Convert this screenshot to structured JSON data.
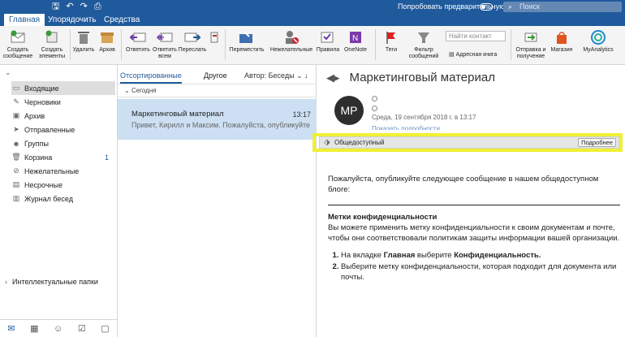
{
  "titlebar": {
    "icons": [
      "grid-icon",
      "save-icon",
      "undo-icon",
      "redo-icon",
      "print-icon"
    ],
    "preview_label": "Попробовать предварительную версию",
    "search_placeholder": "Поиск"
  },
  "tabs": [
    "Главная",
    "Упорядочить",
    "Средства"
  ],
  "ribbon": {
    "new_email": "Создать сообщение",
    "new_items": "Создать элементы",
    "delete": "Удалить",
    "archive": "Архив",
    "reply": "Ответить",
    "reply_all": "Ответить всем",
    "forward": "Переслать",
    "move": "Переместить",
    "junk": "Нежелательные",
    "rules": "Правила",
    "onenote": "OneNote",
    "tags": "Теги",
    "filter": "Фильтр сообщений",
    "find_contact_placeholder": "Найти контакт",
    "address_book": "Адресная книга",
    "send_receive": "Отправка и получение",
    "store": "Магазин",
    "myanalytics": "MyAnalytics"
  },
  "folders": [
    {
      "name": "Входящие",
      "count": "",
      "icon": "inbox-icon",
      "selected": true
    },
    {
      "name": "Черновики",
      "count": "",
      "icon": "drafts-icon"
    },
    {
      "name": "Архив",
      "count": "",
      "icon": "archive-icon"
    },
    {
      "name": "Отправленные",
      "count": "",
      "icon": "sent-icon"
    },
    {
      "name": "Группы",
      "count": "",
      "icon": "groups-icon"
    },
    {
      "name": "Корзина",
      "count": "1",
      "icon": "trash-icon"
    },
    {
      "name": "Нежелательные",
      "count": "",
      "icon": "junk-icon"
    },
    {
      "name": "Несрочные",
      "count": "",
      "icon": "clutter-icon"
    },
    {
      "name": "Журнал бесед",
      "count": "",
      "icon": "conversation-history-icon"
    }
  ],
  "smart_folders": "Интеллектуальные папки",
  "message_list": {
    "tab_focused": "Отсортированные",
    "tab_other": "Другое",
    "sort_by": "Автор: Беседы",
    "group_today": "Сегодня",
    "message": {
      "subject": "Маркетинговый материал",
      "time": "13:17",
      "preview": "Привет, Кирилл и Максим. Пожалуйста, опубликуйте..."
    }
  },
  "reading": {
    "subject": "Маркетинговый материал",
    "avatar": "MP",
    "date": "Среда, 19 сентября 2018 г. в 13:17",
    "details": "Показать подробности",
    "label": "Общедоступный",
    "label_more": "Подробнее",
    "intro": "Пожалуйста, опубликуйте следующее сообщение в нашем общедоступном блоге:",
    "heading": "Метки конфиденциальности",
    "paragraph": "Вы можете применить метку конфиденциальности к своим документам и почте, чтобы они соответствовали политикам защиты информации вашей организации.",
    "step1_pre": "На вкладке ",
    "step1_b1": "Главная",
    "step1_mid": " выберите ",
    "step1_b2": "Конфиденциальность.",
    "step2": "Выберите метку конфиденциальности, которая подходит для документа или почты."
  },
  "colors": {
    "titlebar": "#1f5a9c",
    "selected_message": "#cde0f3",
    "highlight": "#f0f033"
  }
}
